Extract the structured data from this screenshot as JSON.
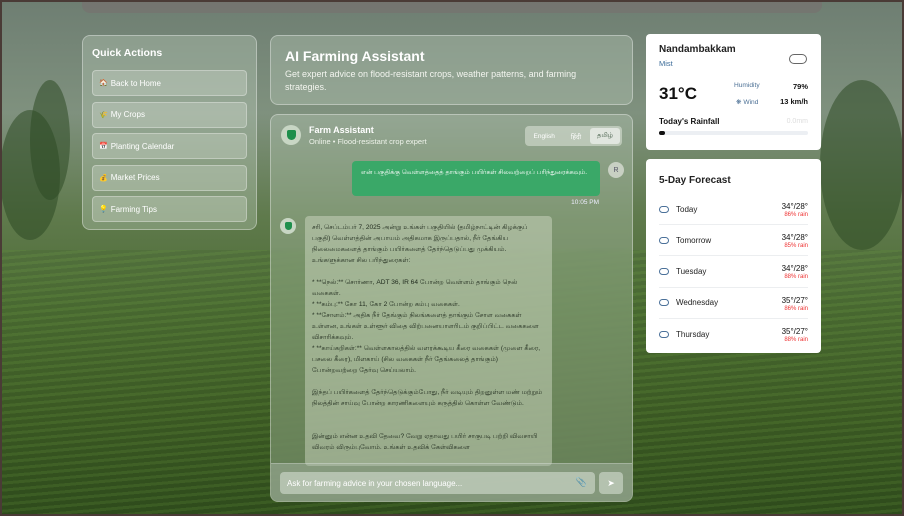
{
  "quick_actions": {
    "title": "Quick Actions",
    "items": [
      {
        "icon": "🏠",
        "label": "Back to Home"
      },
      {
        "icon": "🌾",
        "label": "My Crops"
      },
      {
        "icon": "📅",
        "label": "Planting Calendar"
      },
      {
        "icon": "💰",
        "label": "Market Prices"
      },
      {
        "icon": "💡",
        "label": "Farming Tips"
      }
    ]
  },
  "header": {
    "title": "AI Farming Assistant",
    "subtitle": "Get expert advice on flood-resistant crops, weather patterns, and farming strategies."
  },
  "chat": {
    "assistant_name": "Farm Assistant",
    "assistant_status": "Online • Flood-resistant crop expert",
    "languages": [
      "English",
      "हिंदी",
      "தமிழ்"
    ],
    "active_language": "தமிழ்",
    "user_initial": "R",
    "user_message": "என் பகுதிக்கு வெள்ளத்தைத் தாங்கும் பயிர்கள் சிலவற்றைப் பரிந்துரைக்கவும்.",
    "user_time": "10:05 PM",
    "assistant_message": "சரி, செப்டம்பர் 7, 2025 அன்று உங்கள் பகுதியில் (தமிழ்நாட்டின் கிழக்குப் பகுதி) வெள்ளத்தின் அபாயம் அதிகமாக இருப்பதால், நீர் தேங்கிய நிலைமைகளைத் தாங்கும் பயிர்களைத் தேர்ந்தெடுப்பது முக்கியம். உங்களுக்கான சில பரிந்துரைகள்:\n\n* **நெல்:** சொர்ணா, ADT 36, IR 64 போன்ற வெள்ளம் தாங்கும் நெல் வகைகள்.\n* **கம்பு:** கோ 11, கோ 2 போன்ற கம்பு வகைகள்.\n* **சோளம்:** அதிக நீர் தேங்கும் நிலங்களைத் தாங்கும் சோள வகைகள் உள்ளன, உங்கள் உள்ளூர் விதை விற்பனையாளரிடம் குறிப்பிட்ட வகைகளை விசாரிக்கவும்.\n* **காய்கறிகள்:** வெள்ளகாலத்தில் வளரக்கூடிய கீரை வகைகள் (முளை கீரை, பசலை கீரை), மிளகாய் (சில வகைகள் நீர் தேங்கலைத் தாங்கும்) போன்றவற்றை தேர்வு செய்யலாம்.\n\nஇந்தப் பயிர்களைத் தேர்ந்தெடுக்கும்போது, நீர் வடியும் திறனுள்ள மண் மற்றும் நிலத்தின் சாய்வு போன்ற காரணிகளையும் கருத்தில் கொள்ள வேண்டும்.\n\n\nஇன்னும் என்ன உதவி தேவை? வேறு ஏதாவது பயிர் சாகுபடி பற்றி விவசாயி விவரம் விரும்புவோம். உங்கள் உதவிக் கேள்விகளை",
    "input_placeholder": "Ask for farming advice in your chosen language..."
  },
  "weather": {
    "location": "Nandambakkam",
    "condition": "Mist",
    "condition_icon": "cloud-icon",
    "temperature": "31°C",
    "humidity_label": "Humidity",
    "humidity": "79%",
    "wind_label": "Wind",
    "wind": "13 km/h",
    "rainfall_label": "Today's Rainfall",
    "rainfall_value": "0.0mm",
    "rainfall_fraction": 0.04
  },
  "forecast": {
    "title": "5-Day Forecast",
    "days": [
      {
        "day": "Today",
        "temp": "34°/28°",
        "rain": "86% rain"
      },
      {
        "day": "Tomorrow",
        "temp": "34°/28°",
        "rain": "85% rain"
      },
      {
        "day": "Tuesday",
        "temp": "34°/28°",
        "rain": "88% rain"
      },
      {
        "day": "Wednesday",
        "temp": "35°/27°",
        "rain": "86% rain"
      },
      {
        "day": "Thursday",
        "temp": "35°/27°",
        "rain": "88% rain"
      }
    ]
  }
}
